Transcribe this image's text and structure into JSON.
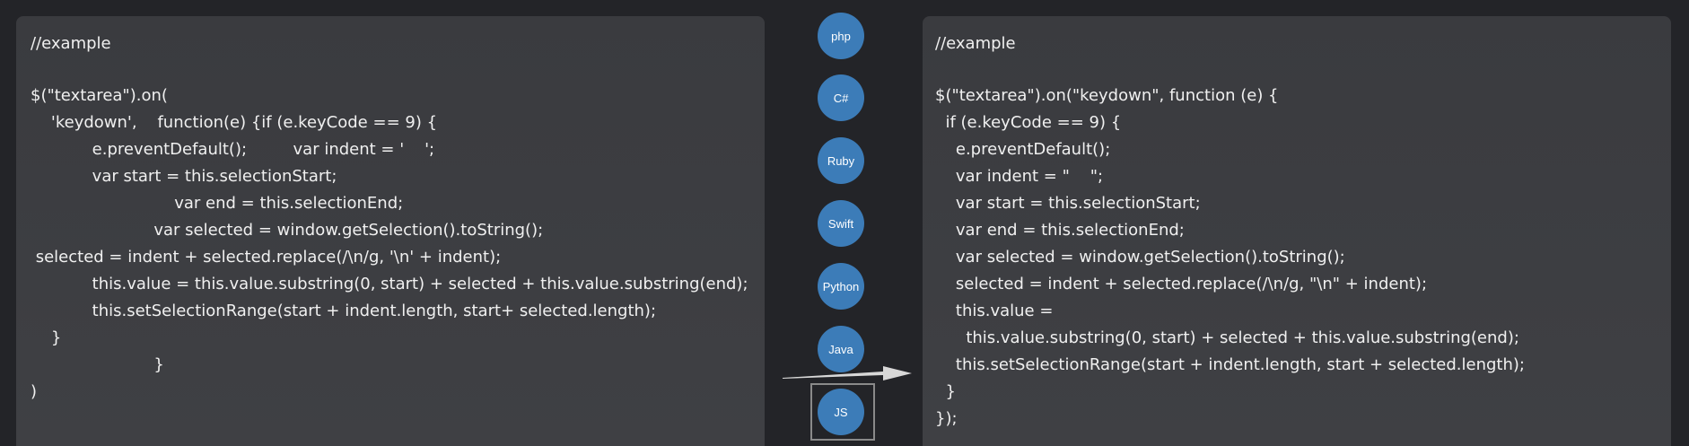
{
  "left_panel": {
    "lines": [
      "//example",
      "",
      "$(\"textarea\").on(",
      "    'keydown',    function(e) {if (e.keyCode == 9) {",
      "            e.preventDefault();         var indent = '    ';",
      "            var start = this.selectionStart;",
      "                            var end = this.selectionEnd;",
      "                        var selected = window.getSelection().toString();",
      " selected = indent + selected.replace(/\\n/g, '\\n' + indent);",
      "            this.value = this.value.substring(0, start) + selected + this.value.substring(end);",
      "            this.setSelectionRange(start + indent.length, start+ selected.length);",
      "    }",
      "                        }",
      ")"
    ]
  },
  "right_panel": {
    "lines": [
      "//example",
      "",
      "$(\"textarea\").on(\"keydown\", function (e) {",
      "  if (e.keyCode == 9) {",
      "    e.preventDefault();",
      "    var indent = \"    \";",
      "    var start = this.selectionStart;",
      "    var end = this.selectionEnd;",
      "    var selected = window.getSelection().toString();",
      "    selected = indent + selected.replace(/\\n/g, \"\\n\" + indent);",
      "    this.value =",
      "      this.value.substring(0, start) + selected + this.value.substring(end);",
      "    this.setSelectionRange(start + indent.length, start + selected.length);",
      "  }",
      "});"
    ]
  },
  "languages": [
    {
      "label": "php"
    },
    {
      "label": "C#"
    },
    {
      "label": "Ruby"
    },
    {
      "label": "Swift"
    },
    {
      "label": "Python"
    },
    {
      "label": "Java"
    },
    {
      "label": "JS",
      "selected": true
    }
  ],
  "colors": {
    "accent": "#3c7cb8",
    "background": "#232428",
    "panel": "#3c3d41",
    "text": "#f0f0f0",
    "arrow": "#d8d8d8"
  },
  "icons": {
    "arrow": "right-arrow-icon"
  }
}
